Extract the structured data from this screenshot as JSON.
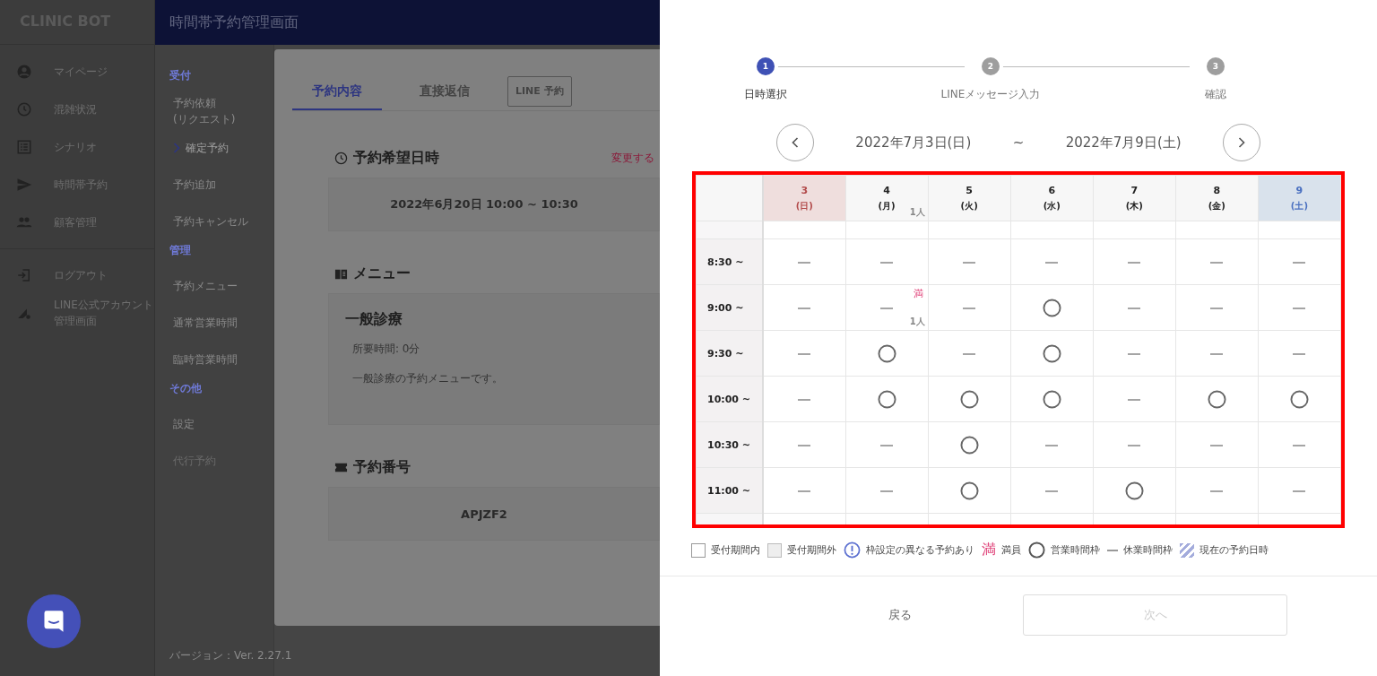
{
  "app": {
    "brand": "CLINIC BOT",
    "header_title": "時間帯予約管理画面",
    "nav": [
      {
        "label": "マイページ"
      },
      {
        "label": "混雑状況"
      },
      {
        "label": "シナリオ"
      },
      {
        "label": "時間帯予約"
      },
      {
        "label": "顧客管理"
      }
    ],
    "nav_bottom": [
      {
        "label": "ログアウト"
      },
      {
        "label": "LINE公式アカウント管理画面"
      }
    ],
    "sub_nav": [
      {
        "heading": "受付",
        "items": [
          {
            "label": "予約依頼\n(リクエスト)",
            "selected": false,
            "disabled": false
          },
          {
            "label": "確定予約",
            "selected": true,
            "disabled": false
          },
          {
            "label": "予約追加",
            "selected": false,
            "disabled": false
          },
          {
            "label": "予約キャンセル",
            "selected": false,
            "disabled": false
          }
        ]
      },
      {
        "heading": "管理",
        "items": [
          {
            "label": "予約メニュー",
            "selected": false,
            "disabled": false
          },
          {
            "label": "通常営業時間",
            "selected": false,
            "disabled": false
          },
          {
            "label": "臨時営業時間",
            "selected": false,
            "disabled": false
          }
        ]
      },
      {
        "heading": "その他",
        "items": [
          {
            "label": "設定",
            "selected": false,
            "disabled": false
          },
          {
            "label": "代行予約",
            "selected": false,
            "disabled": true
          }
        ]
      }
    ],
    "version": "バージョン：Ver. 2.27.1"
  },
  "modal": {
    "tabs": [
      {
        "label": "予約内容",
        "selected": true,
        "kind": "tab"
      },
      {
        "label": "直接返信",
        "selected": false,
        "kind": "tab"
      },
      {
        "label": "LINE 予約",
        "selected": false,
        "kind": "button"
      }
    ],
    "datetime": {
      "title": "予約希望日時",
      "link": "変更する",
      "value": "2022年6月20日 10:00 ~ 10:30"
    },
    "menu": {
      "title": "メニュー",
      "name": "一般診療",
      "duration": "所要時間: 0分",
      "description": "一般診療の予約メニューです。"
    },
    "number": {
      "title": "予約番号",
      "value": "APJZF2"
    }
  },
  "drawer": {
    "steps": [
      {
        "number": "1",
        "label": "日時選択",
        "selected": true
      },
      {
        "number": "2",
        "label": "LINEメッセージ入力",
        "selected": false
      },
      {
        "number": "3",
        "label": "確認",
        "selected": false
      }
    ],
    "range": {
      "start": "2022年7月3日(日)",
      "separator": "~",
      "end": "2022年7月9日(土)"
    },
    "columns": [
      {
        "day": "3",
        "weekday": "(日)",
        "kind": "sunday"
      },
      {
        "day": "4",
        "weekday": "(月)",
        "kind": "weekday",
        "count": "1人"
      },
      {
        "day": "5",
        "weekday": "(火)",
        "kind": "weekday"
      },
      {
        "day": "6",
        "weekday": "(水)",
        "kind": "weekday"
      },
      {
        "day": "7",
        "weekday": "(木)",
        "kind": "weekday"
      },
      {
        "day": "8",
        "weekday": "(金)",
        "kind": "weekday"
      },
      {
        "day": "9",
        "weekday": "(土)",
        "kind": "saturday"
      }
    ],
    "rows": [
      {
        "time": "8:30 ~",
        "cells": [
          {
            "kind": "closed"
          },
          {
            "kind": "closed"
          },
          {
            "kind": "closed"
          },
          {
            "kind": "closed"
          },
          {
            "kind": "closed"
          },
          {
            "kind": "closed"
          },
          {
            "kind": "closed"
          }
        ]
      },
      {
        "time": "9:00 ~",
        "cells": [
          {
            "kind": "closed"
          },
          {
            "kind": "closed",
            "full": "満",
            "count": "1人"
          },
          {
            "kind": "closed"
          },
          {
            "kind": "open"
          },
          {
            "kind": "closed"
          },
          {
            "kind": "closed"
          },
          {
            "kind": "closed"
          }
        ]
      },
      {
        "time": "9:30 ~",
        "cells": [
          {
            "kind": "closed"
          },
          {
            "kind": "open"
          },
          {
            "kind": "closed"
          },
          {
            "kind": "open"
          },
          {
            "kind": "closed"
          },
          {
            "kind": "closed"
          },
          {
            "kind": "closed"
          }
        ]
      },
      {
        "time": "10:00 ~",
        "cells": [
          {
            "kind": "closed"
          },
          {
            "kind": "open"
          },
          {
            "kind": "open"
          },
          {
            "kind": "open"
          },
          {
            "kind": "closed"
          },
          {
            "kind": "open"
          },
          {
            "kind": "open"
          }
        ]
      },
      {
        "time": "10:30 ~",
        "cells": [
          {
            "kind": "closed"
          },
          {
            "kind": "closed"
          },
          {
            "kind": "open"
          },
          {
            "kind": "closed"
          },
          {
            "kind": "closed"
          },
          {
            "kind": "closed"
          },
          {
            "kind": "closed"
          }
        ]
      },
      {
        "time": "11:00 ~",
        "cells": [
          {
            "kind": "closed"
          },
          {
            "kind": "closed"
          },
          {
            "kind": "open"
          },
          {
            "kind": "closed"
          },
          {
            "kind": "open"
          },
          {
            "kind": "closed"
          },
          {
            "kind": "closed"
          }
        ]
      }
    ],
    "legend": [
      {
        "kind": "in_period",
        "label": "受付期間内"
      },
      {
        "kind": "out_period",
        "label": "受付期間外"
      },
      {
        "kind": "different",
        "label": "枠設定の異なる予約あり"
      },
      {
        "kind": "full",
        "mark": "満",
        "label": "満員"
      },
      {
        "kind": "open",
        "label": "営業時間枠"
      },
      {
        "kind": "closed",
        "label": "休業時間枠"
      },
      {
        "kind": "current",
        "label": "現在の予約日時"
      }
    ],
    "back": "戻る",
    "next": {
      "label": "次へ",
      "disabled": true
    }
  }
}
